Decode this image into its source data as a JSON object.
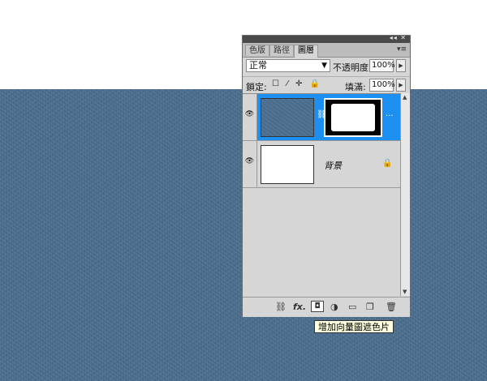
{
  "panel": {
    "tabs": [
      "色版",
      "路徑",
      "圖層"
    ],
    "active_tab_index": 2,
    "titlebar_controls": "◂◂ ✕",
    "menu_icon": "▾≡"
  },
  "controls": {
    "blend_mode": "正常",
    "opacity_label": "不透明度:",
    "opacity_value": "100%",
    "lock_label": "鎖定:",
    "lock_icons": "☐ ⁄ ✛ 🔒",
    "fill_label": "填滿:",
    "fill_value": "100%"
  },
  "layers": [
    {
      "name": "",
      "selected": true,
      "has_mask": true,
      "thumb": "texture"
    },
    {
      "name": "背景",
      "selected": false,
      "locked": true,
      "thumb": "white"
    }
  ],
  "bottom_bar": {
    "icons": [
      "link-icon",
      "fx-icon",
      "add-vector-mask-icon",
      "adjustment-layer-icon",
      "new-group-icon",
      "new-layer-icon",
      "trash-icon"
    ]
  },
  "tooltip": "增加向量圖遮色片",
  "colors": {
    "canvas": "#4a6d8c",
    "selection": "#1c8ff0",
    "panel_bg": "#d6d6d6"
  }
}
